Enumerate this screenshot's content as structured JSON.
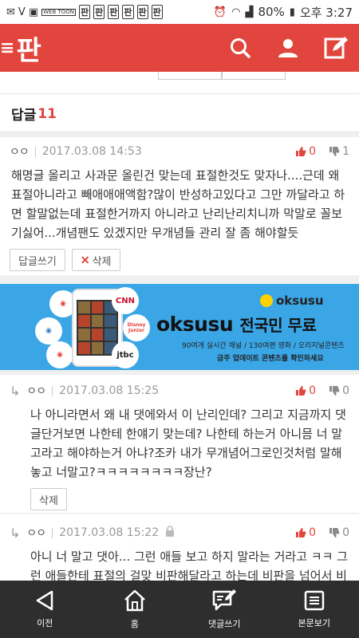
{
  "status_bar": {
    "web_badge": "WEB TOON",
    "app_icons": [
      "판",
      "판",
      "판",
      "판",
      "판",
      "판"
    ],
    "battery": "80%",
    "time": "오후 3:27"
  },
  "header": {
    "logo": "판",
    "icons": [
      "search-icon",
      "user-icon",
      "compose-icon"
    ]
  },
  "reply_header": {
    "label": "답글",
    "count": "11"
  },
  "comments": [
    {
      "nick": "ㅇㅇ",
      "date": "2017.03.08 14:53",
      "up": "0",
      "down": "1",
      "body": "해명글 올리고 사과문 올린건 맞는데 표절한것도 맞자나....근데 왜 표절아니라고 빼애애애액함?많이 반성하고있다고 그만 까달라고 하면 할말없는데 표절한거까지 아니라고 난리난리치니까 막말로 꼴보기싫어...개념팬도 있겠지만 무개념들 관리 잘 좀 해야할듯",
      "reply_btn": "답글쓰기",
      "delete_btn": "삭제"
    },
    {
      "nick": "ㅇㅇ",
      "date": "2017.03.08 15:25",
      "up": "0",
      "down": "0",
      "body": "나 아니라면서 왜 내 댓에와서 이 난리인데? 그리고 지금까지 댓글단거보면 나한테 한얘기 맞는데? 나한테 하는거 아니믐 너 말고라고 해야하는거 아냐?조카 내가 무개념어그로인것처럼 말해놓고 너말고?ㅋㅋㅋㅋㅋㅋㅋㅋ장난?",
      "delete_btn": "삭제"
    },
    {
      "nick": "ㅇㅇ",
      "date": "2017.03.08 15:22",
      "up": "0",
      "down": "0",
      "body": "아니 너 말고 댓아... 그런 애들 보고 하지 말라는 거라고 ㅋㅋ 그런 애들한테 표절의 걸맞 비판해달라고 하는데 비판을 넘어서 비"
    }
  ],
  "banner": {
    "brand": "oksusu",
    "title_brand": "oksusu",
    "title_rest": "전국민 무료",
    "line1": "90여개 실시간 채널 / 130여편 영화 / 오리지널콘텐츠",
    "line2": "금주 업데이트 콘텐츠를 확인하세요",
    "channels": [
      "CNN",
      "Disney Junior",
      "jtbc"
    ]
  },
  "bottom_nav": [
    {
      "label": "이전",
      "icon": "back-icon"
    },
    {
      "label": "홈",
      "icon": "home-icon"
    },
    {
      "label": "댓글쓰기",
      "icon": "write-comment-icon"
    },
    {
      "label": "본문보기",
      "icon": "view-article-icon"
    }
  ],
  "colors": {
    "brand": "#e2453d",
    "banner": "#3aa6e6",
    "bottom_bar": "#2e2e2e"
  }
}
